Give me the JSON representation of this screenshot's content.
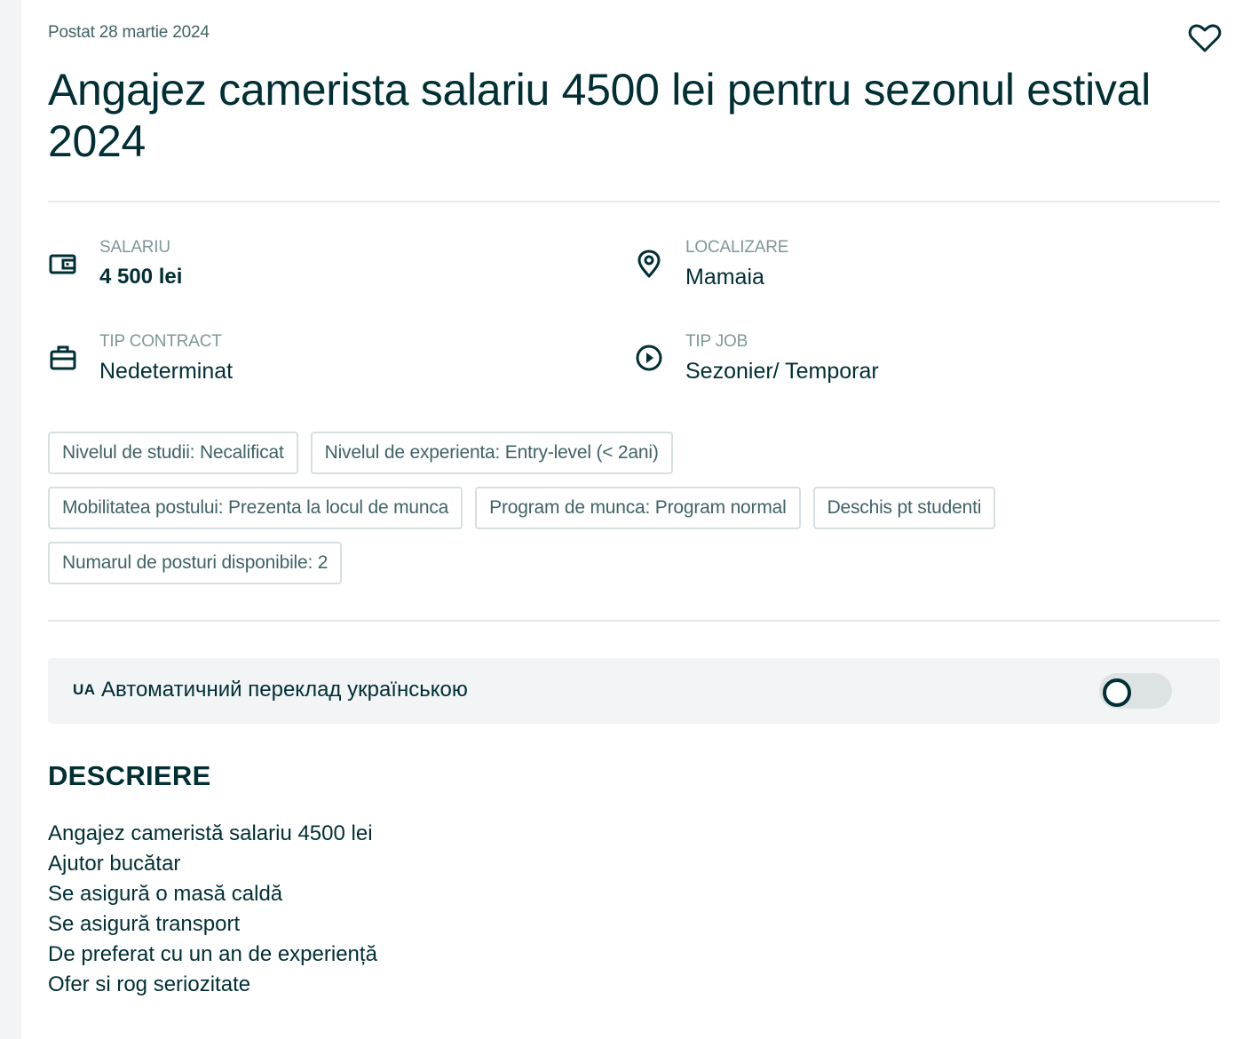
{
  "posted": "Postat 28 martie 2024",
  "title": "Angajez camerista salariu 4500 lei pentru sezonul estival 2024",
  "attributes": {
    "salary": {
      "label": "SALARIU",
      "value": "4 500 lei",
      "icon": "wallet-icon"
    },
    "location": {
      "label": "LOCALIZARE",
      "value": "Mamaia",
      "icon": "location-pin-icon"
    },
    "contract": {
      "label": "TIP CONTRACT",
      "value": "Nedeterminat",
      "icon": "briefcase-icon"
    },
    "job_type": {
      "label": "TIP JOB",
      "value": "Sezonier/ Temporar",
      "icon": "play-circle-icon"
    }
  },
  "tags": [
    "Nivelul de studii: Necalificat",
    "Nivelul de experienta: Entry-level (< 2ani)",
    "Mobilitatea postului: Prezenta la locul de munca",
    "Program de munca: Program normal",
    "Deschis pt studenti",
    "Numarul de posturi disponibile: 2"
  ],
  "translate": {
    "flag": "UA",
    "label": "Автоматичний переклад українською",
    "enabled": false
  },
  "description": {
    "heading": "DESCRIERE",
    "lines": [
      "Angajez cameristă salariu 4500 lei",
      "Ajutor bucătar",
      "Se asigură o masă caldă",
      "Se asigură transport",
      "De preferat cu un an de experiență",
      "Ofer si rog seriozitate"
    ]
  },
  "colors": {
    "text": "#002f34",
    "muted": "#406367",
    "label": "#7f9799",
    "panel": "#f2f4f5"
  }
}
